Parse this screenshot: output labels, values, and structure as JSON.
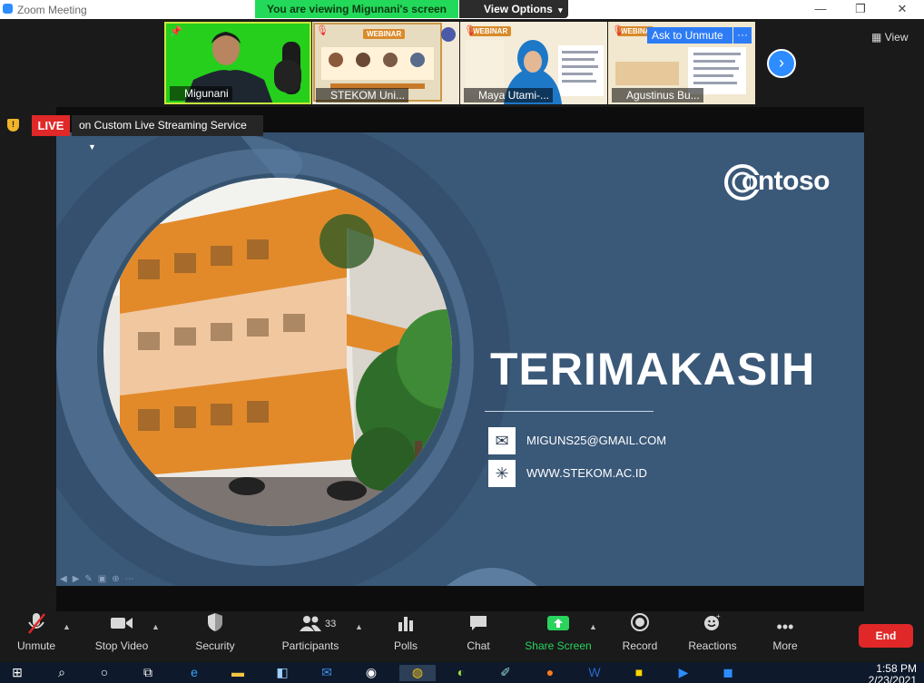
{
  "window": {
    "title": "Zoom Meeting",
    "banner": "You are viewing Migunani's screen",
    "view_options": "View Options",
    "minimize": "—",
    "restore": "❐",
    "close": "✕"
  },
  "participants_strip": [
    {
      "name": "Migunani",
      "icon": "pin-icon"
    },
    {
      "name": "STEKOM Uni...",
      "icon": "mic-muted-icon"
    },
    {
      "name": "Maya Utami-...",
      "icon": "mic-muted-icon"
    },
    {
      "name": "Agustinus Bu...",
      "icon": "mic-muted-icon"
    }
  ],
  "thumb_texts": {
    "webinar": "WEBINAR",
    "webinar_short": "WEBINA"
  },
  "ask_to_unmute": "Ask to Unmute",
  "more_dots": "···",
  "next_arrow": "›",
  "view_label": "View",
  "live": {
    "badge": "LIVE",
    "service": "on Custom Live Streaming Service"
  },
  "slide": {
    "logo": "ontoso",
    "heading": "TERIMAKASIH",
    "email": "MIGUNS25@GMAIL.COM",
    "website": "WWW.STEKOM.AC.ID",
    "email_icon": "mail-icon",
    "website_icon": "network-icon"
  },
  "toolbar": {
    "unmute": "Unmute",
    "stop_video": "Stop Video",
    "security": "Security",
    "participants": "Participants",
    "participants_count": "33",
    "polls": "Polls",
    "chat": "Chat",
    "share_screen": "Share Screen",
    "record": "Record",
    "reactions": "Reactions",
    "more": "More",
    "end": "End"
  },
  "taskbar": {
    "time": "1:58 PM",
    "date": "2/23/2021"
  },
  "colors": {
    "zoom_blue": "#2d8cff",
    "banner_green": "#23d959",
    "live_red": "#e02828",
    "slide_blue": "#3a5878",
    "share_green": "#29d35c"
  }
}
